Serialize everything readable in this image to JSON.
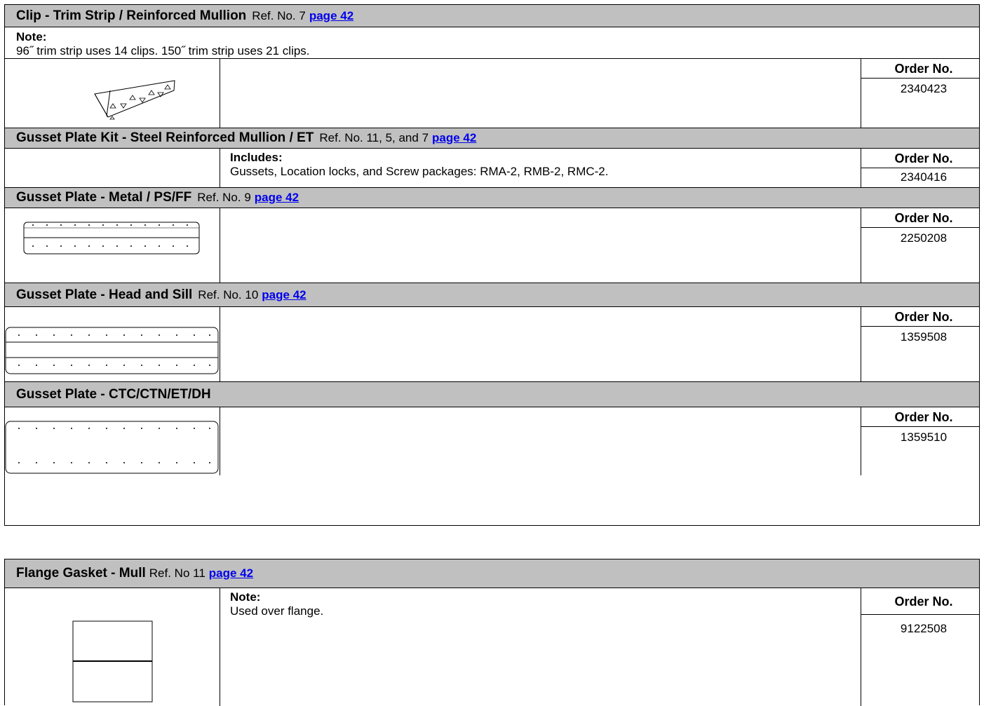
{
  "sections": [
    {
      "title": "Clip - Trim Strip / Reinforced Mullion",
      "ref": "Ref. No. 7",
      "link": "page 42",
      "note_label": "Note:",
      "note_text": "96˝ trim strip uses 14 clips. 150˝ trim strip uses 21 clips.",
      "order_label": "Order No.",
      "order_no": "2340423"
    },
    {
      "title": "Gusset Plate Kit - Steel Reinforced Mullion /  ET",
      "ref": "Ref. No. 11, 5, and 7",
      "link": "page 42",
      "desc_label": "Includes:",
      "desc_text": "Gussets, Location locks, and Screw packages: RMA-2, RMB-2, RMC-2.",
      "order_label": "Order No.",
      "order_no": "2340416"
    },
    {
      "title": "Gusset Plate - Metal / PS/FF",
      "ref": "Ref. No. 9",
      "link": "page 42",
      "order_label": "Order No.",
      "order_no": "2250208"
    },
    {
      "title": "Gusset Plate - Head and Sill",
      "ref": "Ref. No. 10",
      "link": "page 42",
      "order_label": "Order No.",
      "order_no": "1359508"
    },
    {
      "title": "Gusset Plate - CTC/CTN/ET/DH",
      "order_label": "Order No.",
      "order_no": "1359510"
    }
  ],
  "flange": {
    "title": "Flange Gasket - Mull",
    "ref": "Ref. No 11",
    "link": "page 42",
    "desc_label": "Note:",
    "desc_text": "Used over flange.",
    "order_label": "Order No.",
    "order_no": "9122508"
  }
}
